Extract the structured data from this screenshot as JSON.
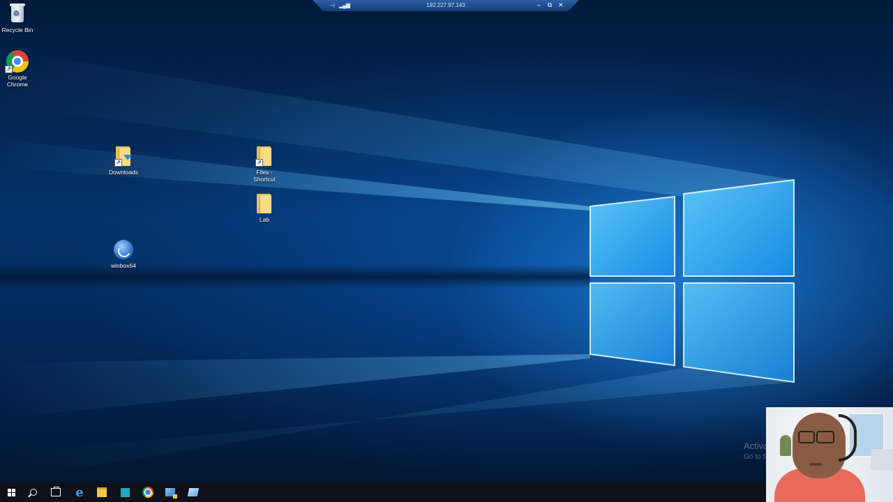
{
  "rdp_bar": {
    "host": "192.227.97.143",
    "pin_icon": "pin-icon",
    "signal_icon": "signal-bars-icon",
    "minimize_label": "–",
    "restore_label": "⧉",
    "close_label": "✕"
  },
  "desktop": {
    "icons": [
      {
        "label": "Recycle Bin",
        "icon": "recycle-bin-icon"
      },
      {
        "label": "Google Chrome",
        "icon": "chrome-icon"
      },
      {
        "label": "Downloads",
        "icon": "downloads-folder-icon"
      },
      {
        "label": "Files - Shortcut",
        "icon": "folder-shortcut-icon"
      },
      {
        "label": "Lab",
        "icon": "folder-icon"
      },
      {
        "label": "winbox64",
        "icon": "winbox-icon"
      }
    ]
  },
  "watermark": {
    "line1": "Activa",
    "line2": "Go to S"
  },
  "taskbar": {
    "items": [
      {
        "icon": "windows-start-icon"
      },
      {
        "icon": "search-icon"
      },
      {
        "icon": "task-view-icon"
      },
      {
        "icon": "internet-explorer-icon",
        "glyph": "e"
      },
      {
        "icon": "file-explorer-icon"
      },
      {
        "icon": "server-manager-store-icon"
      },
      {
        "icon": "chrome-icon"
      },
      {
        "icon": "server-manager-icon"
      },
      {
        "icon": "powershell-icon"
      }
    ]
  },
  "colors": {
    "wallpaper_dark": "#031f44",
    "wallpaper_glow": "#2ea0ff",
    "taskbar": "#0c111a",
    "rdp_bar": "#1e4b8c"
  }
}
